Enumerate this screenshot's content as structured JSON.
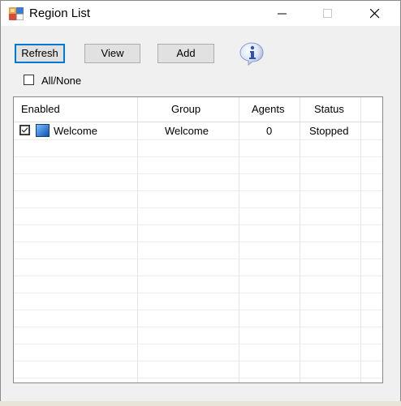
{
  "window": {
    "title": "Region List"
  },
  "toolbar": {
    "refresh_label": "Refresh",
    "view_label": "View",
    "add_label": "Add",
    "info_icon": "info-icon"
  },
  "filter": {
    "all_none_label": "All/None",
    "all_none_checked": false
  },
  "grid": {
    "columns": [
      "Enabled",
      "Group",
      "Agents",
      "Status"
    ],
    "rows": [
      {
        "enabled": true,
        "name": "Welcome",
        "group": "Welcome",
        "agents": "0",
        "status": "Stopped"
      }
    ]
  },
  "colors": {
    "accent": "#0078d7",
    "button_bg": "#e1e1e1",
    "window_bg": "#f0f0f0"
  }
}
